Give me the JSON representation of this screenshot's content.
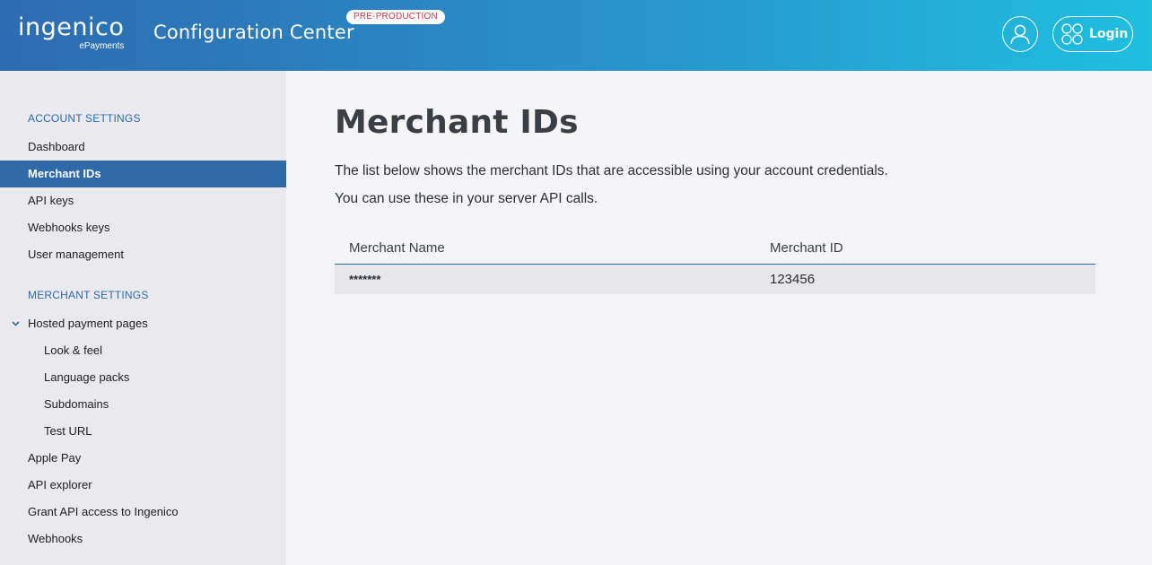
{
  "header": {
    "logo_main": "ingenico",
    "logo_sub": "ePayments",
    "app_title": "Configuration Center",
    "env_badge": "PRE-PRODUCTION",
    "login_label": "Login"
  },
  "sidebar": {
    "account_heading": "ACCOUNT SETTINGS",
    "account_items": [
      {
        "label": "Dashboard"
      },
      {
        "label": "Merchant IDs",
        "active": true
      },
      {
        "label": "API keys"
      },
      {
        "label": "Webhooks keys"
      },
      {
        "label": "User management"
      }
    ],
    "merchant_heading": "MERCHANT SETTINGS",
    "merchant_items": [
      {
        "label": "Hosted payment pages",
        "expanded": true
      },
      {
        "label": "Look & feel"
      },
      {
        "label": "Language packs"
      },
      {
        "label": "Subdomains"
      },
      {
        "label": "Test URL"
      },
      {
        "label": "Apple Pay"
      },
      {
        "label": "API explorer"
      },
      {
        "label": "Grant API access to Ingenico"
      },
      {
        "label": "Webhooks"
      }
    ]
  },
  "main": {
    "title": "Merchant IDs",
    "description_line1": "The list below shows the merchant IDs that are accessible using your account credentials.",
    "description_line2": "You can use these in your server API calls.",
    "table": {
      "headers": [
        "Merchant Name",
        "Merchant ID"
      ],
      "rows": [
        [
          "*******",
          "123456"
        ]
      ]
    }
  },
  "colors": {
    "accent": "#2f69a8",
    "badge_text": "#d0364b",
    "header_gradient_start": "#2d6bb0",
    "header_gradient_end": "#1fbfe0"
  }
}
